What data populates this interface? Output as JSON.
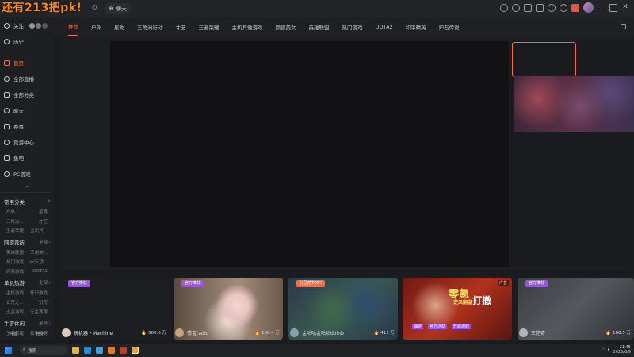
{
  "promo_text": "还有213把pk!",
  "topbar": {
    "o_label": "O",
    "chat_label": "聊天",
    "icons": [
      "clock-icon",
      "heart-icon",
      "list-icon",
      "message-icon",
      "chat-icon",
      "settings-icon",
      "gift-icon",
      "user-avatar",
      "minimize-icon",
      "maximize-icon",
      "close-icon"
    ]
  },
  "sidebar": {
    "follow": "关注",
    "history": "历史",
    "nav": [
      {
        "label": "首页",
        "active": true
      },
      {
        "label": "全部直播"
      },
      {
        "label": "全部分类"
      },
      {
        "label": "聊天"
      },
      {
        "label": "赛事"
      },
      {
        "label": "竞游中心"
      },
      {
        "label": "鱼吧"
      },
      {
        "label": "PC游戏"
      }
    ],
    "groups": [
      {
        "title": "常用分类",
        "more": "✎",
        "subs": [
          [
            "户外",
            "星秀"
          ],
          [
            "三角洲...",
            "才艺"
          ],
          [
            "王者荣耀",
            "主机其..."
          ]
        ]
      },
      {
        "title": "网游竞技",
        "more": "全部 ›",
        "subs": [
          [
            "英雄联盟",
            "三角洲..."
          ],
          [
            "热门游戏",
            "lol云顶..."
          ],
          [
            "网易游戏",
            "DOTA2"
          ]
        ]
      },
      {
        "title": "单机热游",
        "more": "全部 ›",
        "subs": [
          [
            "主机游戏",
            "怀旧游戏"
          ],
          [
            "饥荒之...",
            "饥荒"
          ],
          [
            "土豆游戏",
            "无主界限"
          ]
        ]
      },
      {
        "title": "手游休闲",
        "more": "全部 ›",
        "subs": [
          [
            "王者荣耀",
            "和平精英"
          ]
        ]
      }
    ],
    "bottom": [
      "开播",
      "鱼吧"
    ]
  },
  "tabs": [
    "推荐",
    "户外",
    "星秀",
    "三角洲行动",
    "才艺",
    "王者荣耀",
    "主机其他游戏",
    "颜值美女",
    "英雄联盟",
    "热门游戏",
    "DOTA2",
    "和平精英",
    "炉石传说"
  ],
  "cards": [
    {
      "badge": "官方推荐",
      "name": "玩机器丶Machine",
      "count": "500.6 万"
    },
    {
      "badge": "官方推荐",
      "name": "倩宝radio",
      "count": "166.4 万"
    },
    {
      "badge": "分区前TOP3",
      "name": "金咕咕金咕咕doinb",
      "count": "411 万"
    },
    {
      "ad": "广告",
      "title": "零氪",
      "sub": "逆风翻盘",
      "tag": "打撤",
      "chips": [
        "抽奖",
        "官方活动",
        "开启游戏"
      ]
    },
    {
      "badge": "官方推荐",
      "name": "王陀奇",
      "count": "168.5 万"
    }
  ],
  "taskbar": {
    "search": "搜索",
    "time": "21:45",
    "date": "2025/6/9"
  },
  "colors": {
    "accent": "#ff6a3d",
    "badge": "#9a52e8",
    "promo": "#ff8a1e"
  }
}
